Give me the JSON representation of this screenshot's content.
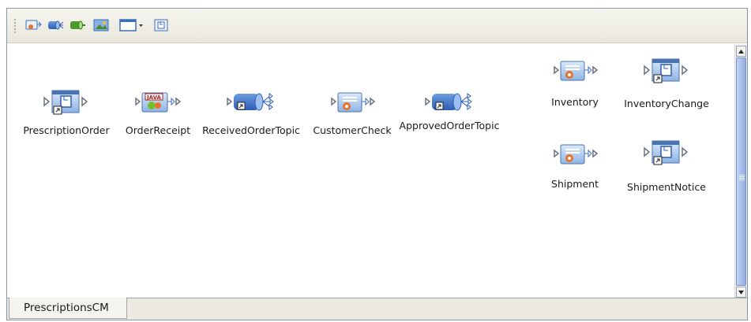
{
  "toolbar": {
    "buttons": [
      {
        "icon": "add-service-icon"
      },
      {
        "icon": "add-topic-icon"
      },
      {
        "icon": "add-queue-icon"
      },
      {
        "icon": "add-web-app-icon"
      },
      {
        "icon": "add-external-app-icon"
      },
      {
        "icon": "add-web-connector-icon"
      }
    ]
  },
  "nodes": [
    {
      "label": "PrescriptionOrder",
      "icon": "external-application-icon"
    },
    {
      "label": "OrderReceipt",
      "icon": "java-service-icon"
    },
    {
      "label": "ReceivedOrderTopic",
      "icon": "topic-icon"
    },
    {
      "label": "CustomerCheck",
      "icon": "service-icon"
    },
    {
      "label": "ApprovedOrderTopic",
      "icon": "topic-icon"
    },
    {
      "label": "Inventory",
      "icon": "service-icon"
    },
    {
      "label": "InventoryChange",
      "icon": "external-application-icon"
    },
    {
      "label": "Shipment",
      "icon": "service-icon"
    },
    {
      "label": "ShipmentNotice",
      "icon": "external-application-icon"
    }
  ],
  "tabs": [
    {
      "label": "PrescriptionsCM",
      "active": true
    }
  ],
  "colors": {
    "accent": "#3b73d8",
    "border": "#8a96a6"
  }
}
